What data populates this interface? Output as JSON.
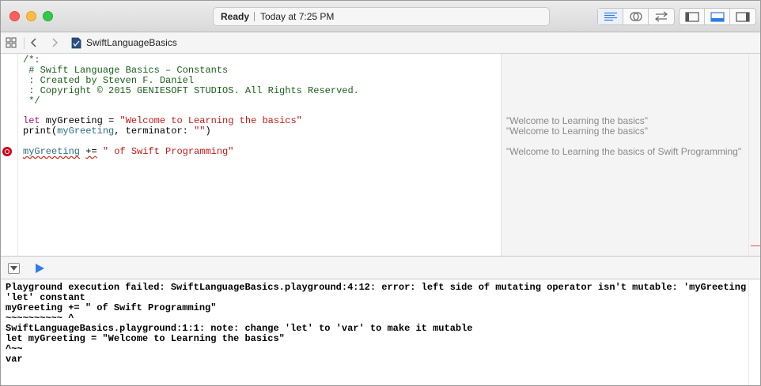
{
  "titlebar": {
    "status_state": "Ready",
    "status_time": "Today at 7:25 PM",
    "icons": [
      "standard-editor-icon",
      "assistant-editor-icon",
      "version-editor-icon",
      "navigator-toggle-icon",
      "debug-area-toggle-icon",
      "utilities-toggle-icon"
    ]
  },
  "jumpbar": {
    "file_name": "SwiftLanguageBasics"
  },
  "editor": {
    "comment": {
      "open": "/*:",
      "title": " # Swift Language Basics – Constants",
      "author": " : Created by Steven F. Daniel",
      "copyright": " : Copyright © 2015 GENIESOFT STUDIOS. All Rights Reserved.",
      "close": " */"
    },
    "line1": {
      "kw": "let",
      "name": " myGreeting = ",
      "str": "\"Welcome to Learning the basics\""
    },
    "line2": {
      "fn": "print(",
      "arg": "myGreeting",
      "rest": ", terminator: ",
      "str": "\"\"",
      "close": ")"
    },
    "line3": {
      "name": "myGreeting",
      "sp": " ",
      "op": "+=",
      "str": " \" of Swift Programming\""
    }
  },
  "results": {
    "r1": "\"Welcome to Learning the basics\"",
    "r2": "\"Welcome to Learning the basics\"",
    "r3": "\"Welcome to Learning the basics of Swift Programming\""
  },
  "console": {
    "lines": [
      "Playground execution failed: SwiftLanguageBasics.playground:4:12: error: left side of mutating operator isn't mutable: 'myGreeting' is a",
      "'let' constant",
      "myGreeting += \" of Swift Programming\"",
      "~~~~~~~~~~ ^",
      "SwiftLanguageBasics.playground:1:1: note: change 'let' to 'var' to make it mutable",
      "let myGreeting = \"Welcome to Learning the basics\"",
      "^~~",
      "var"
    ]
  },
  "colors": {
    "comment": "#1c5d1c",
    "keyword": "#a2127a",
    "string": "#c41a16",
    "identifier": "#2e6d85",
    "error": "#d0021b",
    "accent": "#2f7ee0"
  }
}
